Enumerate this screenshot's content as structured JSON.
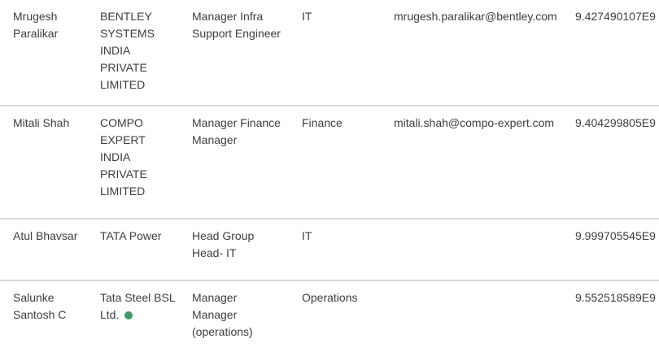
{
  "table": {
    "rows": [
      {
        "name": [
          "Mrugesh",
          "Paralikar"
        ],
        "company": [
          "BENTLEY",
          "SYSTEMS",
          "INDIA",
          "PRIVATE",
          "LIMITED"
        ],
        "designation": [
          "Manager Infra",
          "Support Engineer"
        ],
        "department": "IT",
        "email": "mrugesh.paralikar@bentley.com",
        "phone": "9.427490107E9"
      },
      {
        "name": [
          "Mitali Shah"
        ],
        "company": [
          "COMPO",
          "EXPERT",
          "INDIA",
          "PRIVATE",
          "LIMITED"
        ],
        "designation": [
          "Manager Finance",
          "Manager"
        ],
        "department": "Finance",
        "email": "mitali.shah@compo-expert.com",
        "phone": "9.404299805E9"
      },
      {
        "name": [
          "Atul Bhavsar"
        ],
        "company": [
          "TATA Power"
        ],
        "designation": [
          "Head Group",
          "Head- IT"
        ],
        "department": "IT",
        "email": "",
        "phone": "9.999705545E9"
      },
      {
        "name": [
          "Salunke",
          "Santosh C"
        ],
        "company": [
          "Tata Steel BSL",
          "Ltd."
        ],
        "designation": [
          "Manager",
          "Manager",
          "(operations)"
        ],
        "department": "Operations",
        "email": "",
        "phone": "9.552518589E9",
        "status_icon": "online-status-dot",
        "status_color": "#3e9b6b"
      }
    ]
  }
}
